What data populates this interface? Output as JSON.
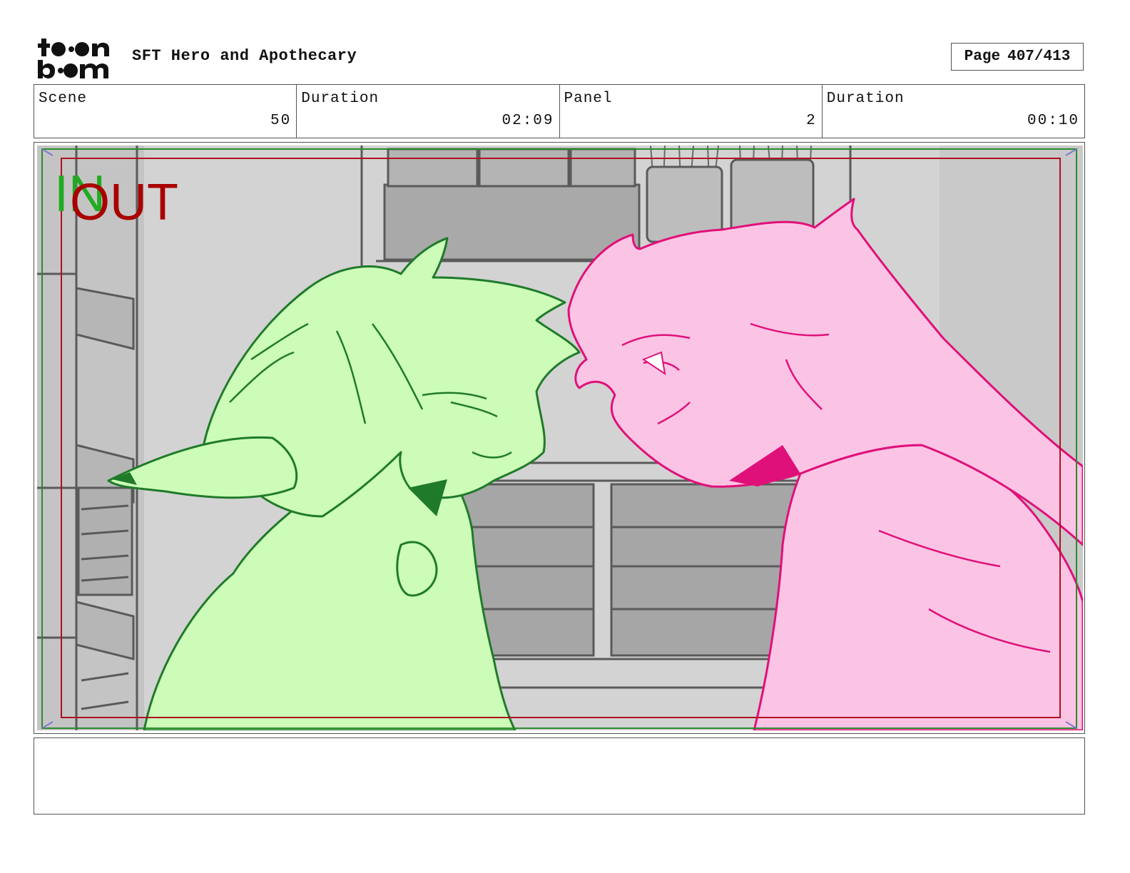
{
  "header": {
    "project_title": "SFT Hero and Apothecary",
    "page_label": "Page",
    "page_value": "407/413"
  },
  "info": {
    "scene_label": "Scene",
    "scene_value": "50",
    "scene_duration_label": "Duration",
    "scene_duration_value": "02:09",
    "panel_label": "Panel",
    "panel_value": "2",
    "panel_duration_label": "Duration",
    "panel_duration_value": "00:10"
  },
  "panel": {
    "in_marker": "IN",
    "out_marker": "OUT",
    "in_color": "#22aa22",
    "out_color": "#aa0000"
  },
  "logo": {
    "icon": "toon-boom-logo-icon",
    "lettering": "toon boom"
  },
  "colors": {
    "left_character_fill": "#ccfcb8",
    "left_character_line": "#1f7a2a",
    "right_character_fill": "#fcc4e4",
    "right_character_line": "#e0107a",
    "background_gray": "#cfcfcf"
  }
}
